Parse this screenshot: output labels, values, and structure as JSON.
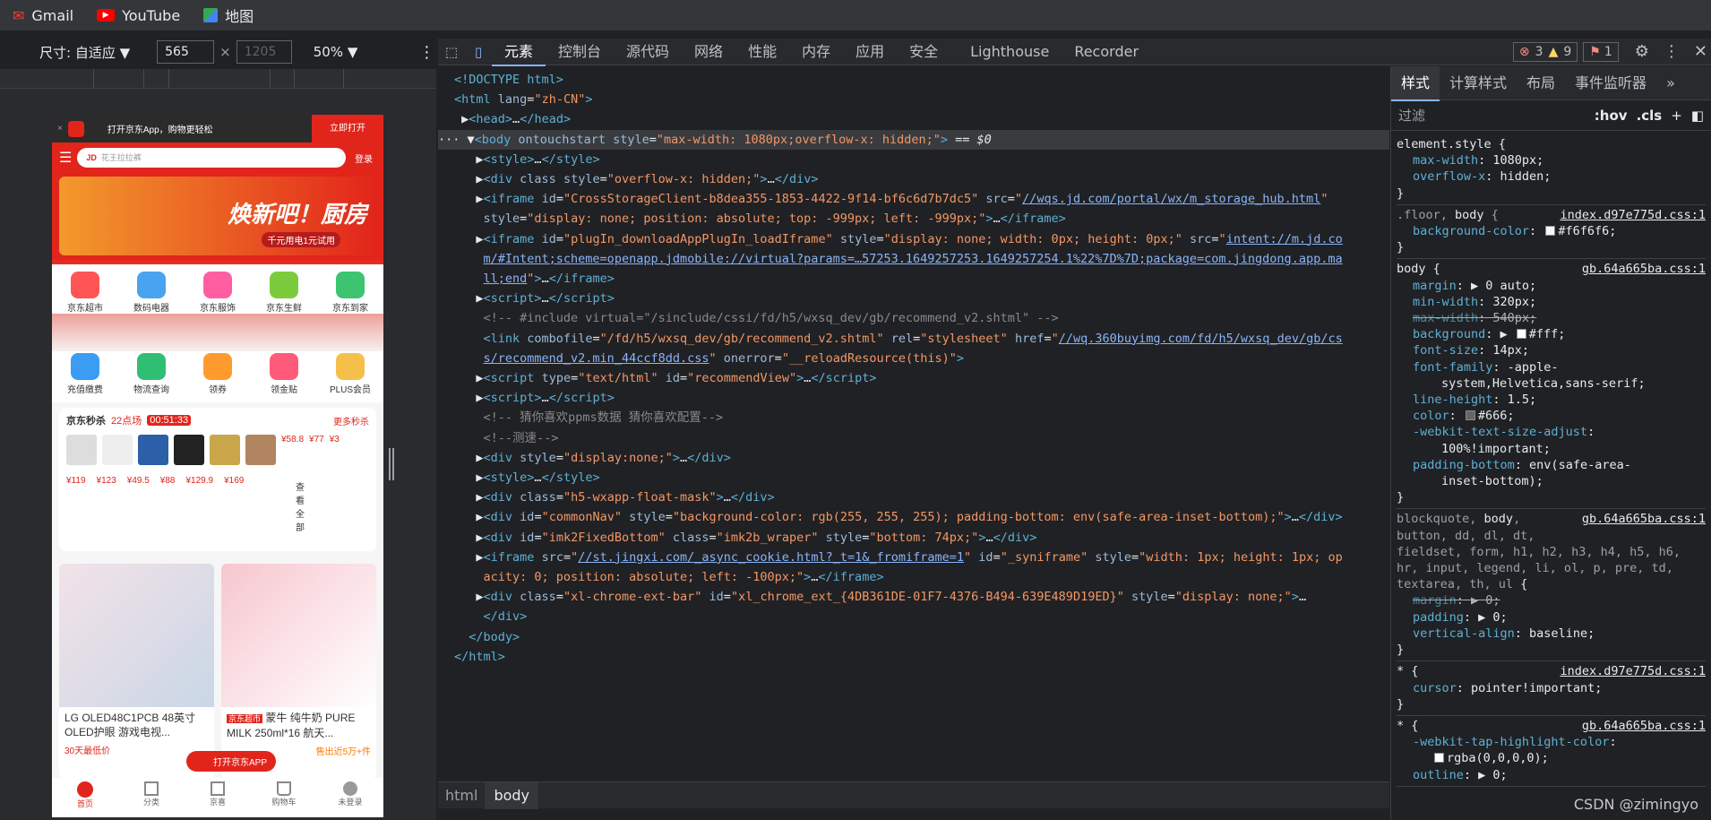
{
  "bookmarks": [
    "Gmail",
    "YouTube",
    "地图"
  ],
  "device": {
    "size_label": "尺寸: 自适应 ▼",
    "width": "565",
    "height_placeholder": "1205",
    "zoom": "50% ▼"
  },
  "devtools": {
    "tabs": [
      "元素",
      "控制台",
      "源代码",
      "网络",
      "性能",
      "内存",
      "应用",
      "安全",
      "Lighthouse",
      "Recorder"
    ],
    "badges": {
      "errors": "3",
      "warnings": "9",
      "issues": "1"
    },
    "breadcrumbs": [
      "html",
      "body"
    ]
  },
  "styles_panel": {
    "tabs": [
      "样式",
      "计算样式",
      "布局",
      "事件监听器"
    ],
    "filter_placeholder": "过滤",
    "hov": ":hov",
    ".cls": ".cls"
  },
  "phone": {
    "banner_text": "打开京东App，购物更轻松",
    "banner_btn": "立即打开",
    "search_placeholder": "花王拉拉裤",
    "login": "登录",
    "hero_text": "焕新吧！厨房",
    "hero_sub": "千元用电1元试用",
    "icons_row1": [
      "京东超市",
      "数码电器",
      "京东服饰",
      "京东生鲜",
      "京东到家"
    ],
    "icons_row2": [
      "充值缴费",
      "物流查询",
      "领券",
      "领金贴",
      "PLUS会员"
    ],
    "seckill_title": "京东秒杀",
    "seckill_hour": "22点场",
    "seckill_timer": "00:51:33",
    "seckill_more": "更多秒杀",
    "prices": [
      "¥119",
      "¥123",
      "¥49.5",
      "¥88",
      "¥129.9",
      "¥169"
    ],
    "prices2": [
      "¥58.8",
      "¥77",
      "¥3"
    ],
    "see_all": "查看全部",
    "lg_title": "LG OLED48C1PCB 48英寸 OLED护眼 游戏电视...",
    "lg_tag": "30天最低价",
    "milk_title": "蒙牛 纯牛奶 PURE MILK 250ml*16 航天...",
    "milk_tag": "京东超市",
    "milk_sold": "售出近5万+件",
    "open_app": "打开京东APP",
    "nav": [
      "首页",
      "分类",
      "京喜",
      "购物车",
      "未登录"
    ]
  },
  "watermark": "CSDN @zimingyo"
}
